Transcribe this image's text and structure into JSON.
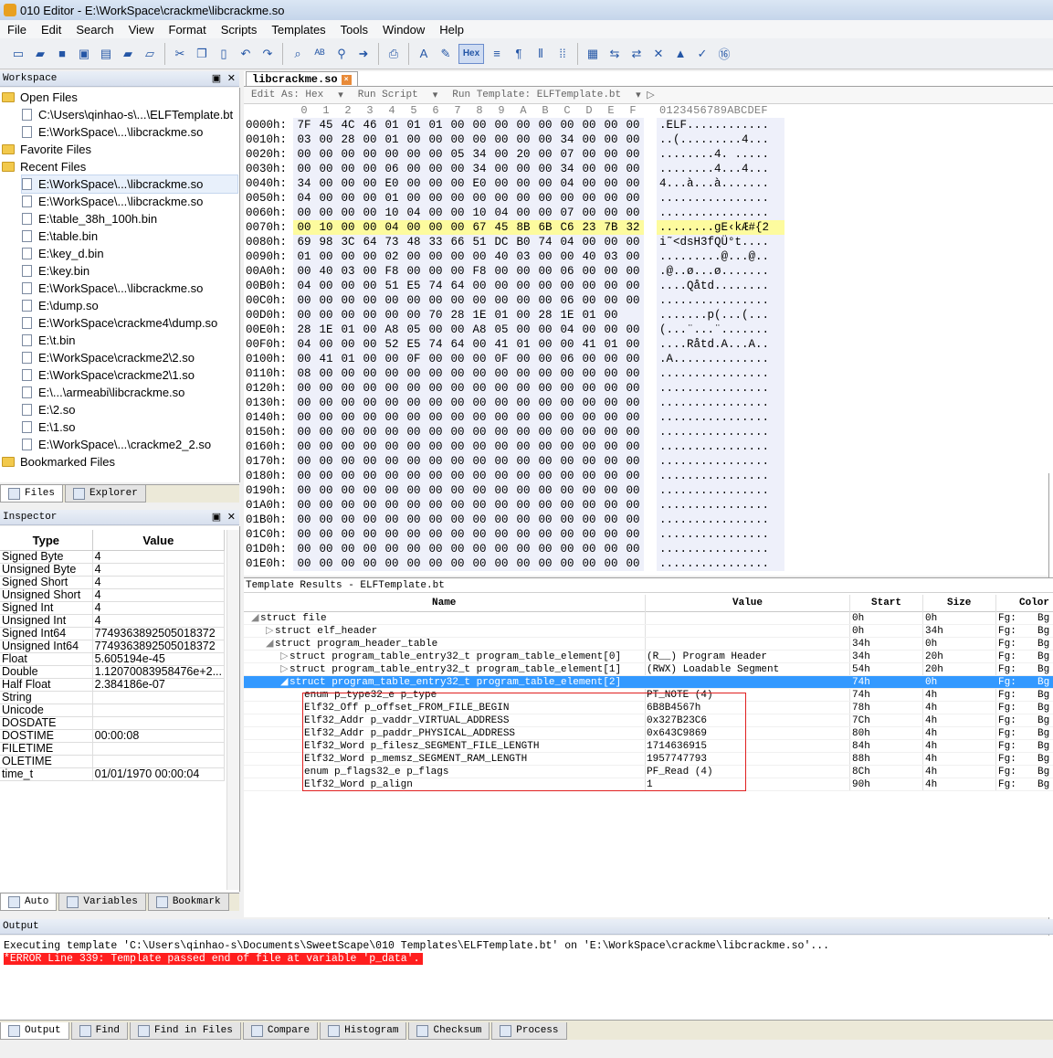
{
  "window": {
    "title": "010 Editor - E:\\WorkSpace\\crackme\\libcrackme.so"
  },
  "menu": [
    "File",
    "Edit",
    "Search",
    "View",
    "Format",
    "Scripts",
    "Templates",
    "Tools",
    "Window",
    "Help"
  ],
  "toolbar": {
    "hex_label": "Hex"
  },
  "workspace": {
    "title": "Workspace",
    "items": [
      {
        "type": "folder",
        "label": "Open Files",
        "indent": 0
      },
      {
        "type": "file",
        "label": "C:\\Users\\qinhao-s\\...\\ELFTemplate.bt",
        "indent": 1
      },
      {
        "type": "file",
        "label": "E:\\WorkSpace\\...\\libcrackme.so",
        "indent": 1
      },
      {
        "type": "folder",
        "label": "Favorite Files",
        "indent": 0
      },
      {
        "type": "folder",
        "label": "Recent Files",
        "indent": 0
      },
      {
        "type": "file",
        "label": "E:\\WorkSpace\\...\\libcrackme.so",
        "indent": 1,
        "selected": true
      },
      {
        "type": "file",
        "label": "E:\\WorkSpace\\...\\libcrackme.so",
        "indent": 1
      },
      {
        "type": "file",
        "label": "E:\\table_38h_100h.bin",
        "indent": 1
      },
      {
        "type": "file",
        "label": "E:\\table.bin",
        "indent": 1
      },
      {
        "type": "file",
        "label": "E:\\key_d.bin",
        "indent": 1
      },
      {
        "type": "file",
        "label": "E:\\key.bin",
        "indent": 1
      },
      {
        "type": "file",
        "label": "E:\\WorkSpace\\...\\libcrackme.so",
        "indent": 1
      },
      {
        "type": "file",
        "label": "E:\\dump.so",
        "indent": 1
      },
      {
        "type": "file",
        "label": "E:\\WorkSpace\\crackme4\\dump.so",
        "indent": 1
      },
      {
        "type": "file",
        "label": "E:\\t.bin",
        "indent": 1
      },
      {
        "type": "file",
        "label": "E:\\WorkSpace\\crackme2\\2.so",
        "indent": 1
      },
      {
        "type": "file",
        "label": "E:\\WorkSpace\\crackme2\\1.so",
        "indent": 1
      },
      {
        "type": "file",
        "label": "E:\\...\\armeabi\\libcrackme.so",
        "indent": 1
      },
      {
        "type": "file",
        "label": "E:\\2.so",
        "indent": 1
      },
      {
        "type": "file",
        "label": "E:\\1.so",
        "indent": 1
      },
      {
        "type": "file",
        "label": "E:\\WorkSpace\\...\\crackme2_2.so",
        "indent": 1
      },
      {
        "type": "folder",
        "label": "Bookmarked Files",
        "indent": 0
      }
    ],
    "tabs": [
      "Files",
      "Explorer"
    ]
  },
  "inspector": {
    "title": "Inspector",
    "col_type": "Type",
    "col_value": "Value",
    "rows": [
      [
        "Signed Byte",
        "4"
      ],
      [
        "Unsigned Byte",
        "4"
      ],
      [
        "Signed Short",
        "4"
      ],
      [
        "Unsigned Short",
        "4"
      ],
      [
        "Signed Int",
        "4"
      ],
      [
        "Unsigned Int",
        "4"
      ],
      [
        "Signed Int64",
        "7749363892505018372"
      ],
      [
        "Unsigned Int64",
        "7749363892505018372"
      ],
      [
        "Float",
        "5.605194e-45"
      ],
      [
        "Double",
        "1.12070083958476e+2..."
      ],
      [
        "Half Float",
        "2.384186e-07"
      ],
      [
        "String",
        ""
      ],
      [
        "Unicode",
        ""
      ],
      [
        "DOSDATE",
        ""
      ],
      [
        "DOSTIME",
        "00:00:08"
      ],
      [
        "FILETIME",
        ""
      ],
      [
        "OLETIME",
        ""
      ],
      [
        "time_t",
        "01/01/1970 00:00:04"
      ]
    ],
    "tabs": [
      "Auto",
      "Variables",
      "Bookmark"
    ]
  },
  "editor": {
    "tab": "libcrackme.so",
    "edit_as": "Edit As: Hex",
    "run_script": "Run Script",
    "run_template": "Run Template: ELFTemplate.bt",
    "column_labels": [
      "0",
      "1",
      "2",
      "3",
      "4",
      "5",
      "6",
      "7",
      "8",
      "9",
      "A",
      "B",
      "C",
      "D",
      "E",
      "F"
    ],
    "ascii_header": "0123456789ABCDEF",
    "rows": [
      {
        "addr": "0000h:",
        "bytes": [
          "7F",
          "45",
          "4C",
          "46",
          "01",
          "01",
          "01",
          "00",
          "00",
          "00",
          "00",
          "00",
          "00",
          "00",
          "00",
          "00"
        ],
        "ascii": ".ELF............"
      },
      {
        "addr": "0010h:",
        "bytes": [
          "03",
          "00",
          "28",
          "00",
          "01",
          "00",
          "00",
          "00",
          "00",
          "00",
          "00",
          "00",
          "34",
          "00",
          "00",
          "00"
        ],
        "ascii": "..(.........4..."
      },
      {
        "addr": "0020h:",
        "bytes": [
          "00",
          "00",
          "00",
          "00",
          "00",
          "00",
          "00",
          "05",
          "34",
          "00",
          "20",
          "00",
          "07",
          "00",
          "00",
          "00"
        ],
        "ascii": "........4. ....."
      },
      {
        "addr": "0030h:",
        "bytes": [
          "00",
          "00",
          "00",
          "00",
          "06",
          "00",
          "00",
          "00",
          "34",
          "00",
          "00",
          "00",
          "34",
          "00",
          "00",
          "00"
        ],
        "ascii": "........4...4..."
      },
      {
        "addr": "0040h:",
        "bytes": [
          "34",
          "00",
          "00",
          "00",
          "E0",
          "00",
          "00",
          "00",
          "E0",
          "00",
          "00",
          "00",
          "04",
          "00",
          "00",
          "00"
        ],
        "ascii": "4...à...à......."
      },
      {
        "addr": "0050h:",
        "bytes": [
          "04",
          "00",
          "00",
          "00",
          "01",
          "00",
          "00",
          "00",
          "00",
          "00",
          "00",
          "00",
          "00",
          "00",
          "00",
          "00"
        ],
        "ascii": "................"
      },
      {
        "addr": "0060h:",
        "bytes": [
          "00",
          "00",
          "00",
          "00",
          "10",
          "04",
          "00",
          "00",
          "10",
          "04",
          "00",
          "00",
          "07",
          "00",
          "00",
          "00"
        ],
        "ascii": "................"
      },
      {
        "addr": "0070h:",
        "bytes": [
          "00",
          "10",
          "00",
          "00",
          "04",
          "00",
          "00",
          "00",
          "67",
          "45",
          "8B",
          "6B",
          "C6",
          "23",
          "7B",
          "32"
        ],
        "ascii": "........gE‹kÆ#{2",
        "highlight": true
      },
      {
        "addr": "0080h:",
        "bytes": [
          "69",
          "98",
          "3C",
          "64",
          "73",
          "48",
          "33",
          "66",
          "51",
          "DC",
          "B0",
          "74",
          "04",
          "00",
          "00",
          "00"
        ],
        "ascii": "i˜<dsH3fQÜ°t...."
      },
      {
        "addr": "0090h:",
        "bytes": [
          "01",
          "00",
          "00",
          "00",
          "02",
          "00",
          "00",
          "00",
          "00",
          "40",
          "03",
          "00",
          "00",
          "40",
          "03",
          "00"
        ],
        "ascii": ".........@...@.."
      },
      {
        "addr": "00A0h:",
        "bytes": [
          "00",
          "40",
          "03",
          "00",
          "F8",
          "00",
          "00",
          "00",
          "F8",
          "00",
          "00",
          "00",
          "06",
          "00",
          "00",
          "00"
        ],
        "ascii": ".@..ø...ø......."
      },
      {
        "addr": "00B0h:",
        "bytes": [
          "04",
          "00",
          "00",
          "00",
          "51",
          "E5",
          "74",
          "64",
          "00",
          "00",
          "00",
          "00",
          "00",
          "00",
          "00",
          "00"
        ],
        "ascii": "....Qåtd........"
      },
      {
        "addr": "00C0h:",
        "bytes": [
          "00",
          "00",
          "00",
          "00",
          "00",
          "00",
          "00",
          "00",
          "00",
          "00",
          "00",
          "00",
          "06",
          "00",
          "00",
          "00"
        ],
        "ascii": "................"
      },
      {
        "addr": "00D0h:",
        "bytes": [
          "00",
          "00",
          "00",
          "00",
          "00",
          "00",
          "70",
          "28",
          "1E",
          "01",
          "00",
          "28",
          "1E",
          "01",
          "00"
        ],
        "ascii": ".......p(...(..."
      },
      {
        "addr": "00E0h:",
        "bytes": [
          "28",
          "1E",
          "01",
          "00",
          "A8",
          "05",
          "00",
          "00",
          "A8",
          "05",
          "00",
          "00",
          "04",
          "00",
          "00",
          "00"
        ],
        "ascii": "(...¨...¨......."
      },
      {
        "addr": "00F0h:",
        "bytes": [
          "04",
          "00",
          "00",
          "00",
          "52",
          "E5",
          "74",
          "64",
          "00",
          "41",
          "01",
          "00",
          "00",
          "41",
          "01",
          "00"
        ],
        "ascii": "....Råtd.A...A.."
      },
      {
        "addr": "0100h:",
        "bytes": [
          "00",
          "41",
          "01",
          "00",
          "00",
          "0F",
          "00",
          "00",
          "00",
          "0F",
          "00",
          "00",
          "06",
          "00",
          "00",
          "00"
        ],
        "ascii": ".A.............."
      },
      {
        "addr": "0110h:",
        "bytes": [
          "08",
          "00",
          "00",
          "00",
          "00",
          "00",
          "00",
          "00",
          "00",
          "00",
          "00",
          "00",
          "00",
          "00",
          "00",
          "00"
        ],
        "ascii": "................"
      },
      {
        "addr": "0120h:",
        "bytes": [
          "00",
          "00",
          "00",
          "00",
          "00",
          "00",
          "00",
          "00",
          "00",
          "00",
          "00",
          "00",
          "00",
          "00",
          "00",
          "00"
        ],
        "ascii": "................"
      },
      {
        "addr": "0130h:",
        "bytes": [
          "00",
          "00",
          "00",
          "00",
          "00",
          "00",
          "00",
          "00",
          "00",
          "00",
          "00",
          "00",
          "00",
          "00",
          "00",
          "00"
        ],
        "ascii": "................"
      },
      {
        "addr": "0140h:",
        "bytes": [
          "00",
          "00",
          "00",
          "00",
          "00",
          "00",
          "00",
          "00",
          "00",
          "00",
          "00",
          "00",
          "00",
          "00",
          "00",
          "00"
        ],
        "ascii": "................"
      },
      {
        "addr": "0150h:",
        "bytes": [
          "00",
          "00",
          "00",
          "00",
          "00",
          "00",
          "00",
          "00",
          "00",
          "00",
          "00",
          "00",
          "00",
          "00",
          "00",
          "00"
        ],
        "ascii": "................"
      },
      {
        "addr": "0160h:",
        "bytes": [
          "00",
          "00",
          "00",
          "00",
          "00",
          "00",
          "00",
          "00",
          "00",
          "00",
          "00",
          "00",
          "00",
          "00",
          "00",
          "00"
        ],
        "ascii": "................"
      },
      {
        "addr": "0170h:",
        "bytes": [
          "00",
          "00",
          "00",
          "00",
          "00",
          "00",
          "00",
          "00",
          "00",
          "00",
          "00",
          "00",
          "00",
          "00",
          "00",
          "00"
        ],
        "ascii": "................"
      },
      {
        "addr": "0180h:",
        "bytes": [
          "00",
          "00",
          "00",
          "00",
          "00",
          "00",
          "00",
          "00",
          "00",
          "00",
          "00",
          "00",
          "00",
          "00",
          "00",
          "00"
        ],
        "ascii": "................"
      },
      {
        "addr": "0190h:",
        "bytes": [
          "00",
          "00",
          "00",
          "00",
          "00",
          "00",
          "00",
          "00",
          "00",
          "00",
          "00",
          "00",
          "00",
          "00",
          "00",
          "00"
        ],
        "ascii": "................"
      },
      {
        "addr": "01A0h:",
        "bytes": [
          "00",
          "00",
          "00",
          "00",
          "00",
          "00",
          "00",
          "00",
          "00",
          "00",
          "00",
          "00",
          "00",
          "00",
          "00",
          "00"
        ],
        "ascii": "................"
      },
      {
        "addr": "01B0h:",
        "bytes": [
          "00",
          "00",
          "00",
          "00",
          "00",
          "00",
          "00",
          "00",
          "00",
          "00",
          "00",
          "00",
          "00",
          "00",
          "00",
          "00"
        ],
        "ascii": "................"
      },
      {
        "addr": "01C0h:",
        "bytes": [
          "00",
          "00",
          "00",
          "00",
          "00",
          "00",
          "00",
          "00",
          "00",
          "00",
          "00",
          "00",
          "00",
          "00",
          "00",
          "00"
        ],
        "ascii": "................"
      },
      {
        "addr": "01D0h:",
        "bytes": [
          "00",
          "00",
          "00",
          "00",
          "00",
          "00",
          "00",
          "00",
          "00",
          "00",
          "00",
          "00",
          "00",
          "00",
          "00",
          "00"
        ],
        "ascii": "................"
      },
      {
        "addr": "01E0h:",
        "bytes": [
          "00",
          "00",
          "00",
          "00",
          "00",
          "00",
          "00",
          "00",
          "00",
          "00",
          "00",
          "00",
          "00",
          "00",
          "00",
          "00"
        ],
        "ascii": "................"
      }
    ]
  },
  "template_results": {
    "title": "Template Results - ELFTemplate.bt",
    "columns": {
      "name": "Name",
      "value": "Value",
      "start": "Start",
      "size": "Size",
      "color": "Color"
    },
    "rows": [
      {
        "level": 0,
        "toggle": "open",
        "name": "struct file",
        "value": "",
        "start": "0h",
        "size": "0h",
        "fg": "Fg:",
        "bg": "Bg"
      },
      {
        "level": 1,
        "toggle": "closed",
        "name": "struct elf_header",
        "value": "",
        "start": "0h",
        "size": "34h",
        "fg": "Fg:",
        "bg": "Bg"
      },
      {
        "level": 1,
        "toggle": "open",
        "name": "struct program_header_table",
        "value": "",
        "start": "34h",
        "size": "0h",
        "fg": "Fg:",
        "bg": "Bg"
      },
      {
        "level": 2,
        "toggle": "closed",
        "name": "struct program_table_entry32_t program_table_element[0]",
        "value": "(R__) Program Header",
        "start": "34h",
        "size": "20h",
        "fg": "Fg:",
        "bg": "Bg"
      },
      {
        "level": 2,
        "toggle": "closed",
        "name": "struct program_table_entry32_t program_table_element[1]",
        "value": "(RWX) Loadable Segment",
        "start": "54h",
        "size": "20h",
        "fg": "Fg:",
        "bg": "Bg"
      },
      {
        "level": 2,
        "toggle": "open",
        "name": "struct program_table_entry32_t program_table_element[2]",
        "value": "",
        "start": "74h",
        "size": "0h",
        "fg": "Fg:",
        "bg": "Bg",
        "selected": true
      },
      {
        "level": 3,
        "toggle": "none",
        "name": "enum p_type32_e p_type",
        "value": "PT_NOTE (4)",
        "start": "74h",
        "size": "4h",
        "fg": "Fg:",
        "bg": "Bg"
      },
      {
        "level": 3,
        "toggle": "none",
        "name": "Elf32_Off p_offset_FROM_FILE_BEGIN",
        "value": "6B8B4567h",
        "start": "78h",
        "size": "4h",
        "fg": "Fg:",
        "bg": "Bg"
      },
      {
        "level": 3,
        "toggle": "none",
        "name": "Elf32_Addr p_vaddr_VIRTUAL_ADDRESS",
        "value": "0x327B23C6",
        "start": "7Ch",
        "size": "4h",
        "fg": "Fg:",
        "bg": "Bg"
      },
      {
        "level": 3,
        "toggle": "none",
        "name": "Elf32_Addr p_paddr_PHYSICAL_ADDRESS",
        "value": "0x643C9869",
        "start": "80h",
        "size": "4h",
        "fg": "Fg:",
        "bg": "Bg"
      },
      {
        "level": 3,
        "toggle": "none",
        "name": "Elf32_Word p_filesz_SEGMENT_FILE_LENGTH",
        "value": "1714636915",
        "start": "84h",
        "size": "4h",
        "fg": "Fg:",
        "bg": "Bg"
      },
      {
        "level": 3,
        "toggle": "none",
        "name": "Elf32_Word p_memsz_SEGMENT_RAM_LENGTH",
        "value": "1957747793",
        "start": "88h",
        "size": "4h",
        "fg": "Fg:",
        "bg": "Bg"
      },
      {
        "level": 3,
        "toggle": "none",
        "name": "enum p_flags32_e p_flags",
        "value": "PF_Read (4)",
        "start": "8Ch",
        "size": "4h",
        "fg": "Fg:",
        "bg": "Bg"
      },
      {
        "level": 3,
        "toggle": "none",
        "name": "Elf32_Word p_align",
        "value": "1",
        "start": "90h",
        "size": "4h",
        "fg": "Fg:",
        "bg": "Bg"
      }
    ]
  },
  "output": {
    "title": "Output",
    "line1": "Executing template 'C:\\Users\\qinhao-s\\Documents\\SweetScape\\010 Templates\\ELFTemplate.bt' on 'E:\\WorkSpace\\crackme\\libcrackme.so'...",
    "line2": "*ERROR Line 339: Template passed end of file at variable 'p_data'.",
    "tabs": [
      "Output",
      "Find",
      "Find in Files",
      "Compare",
      "Histogram",
      "Checksum",
      "Process"
    ]
  },
  "colors": {
    "highlight": "#fdfb9e",
    "selection": "#3399ff",
    "error": "#ff1e1e",
    "hexbg": "#eef0fa"
  }
}
